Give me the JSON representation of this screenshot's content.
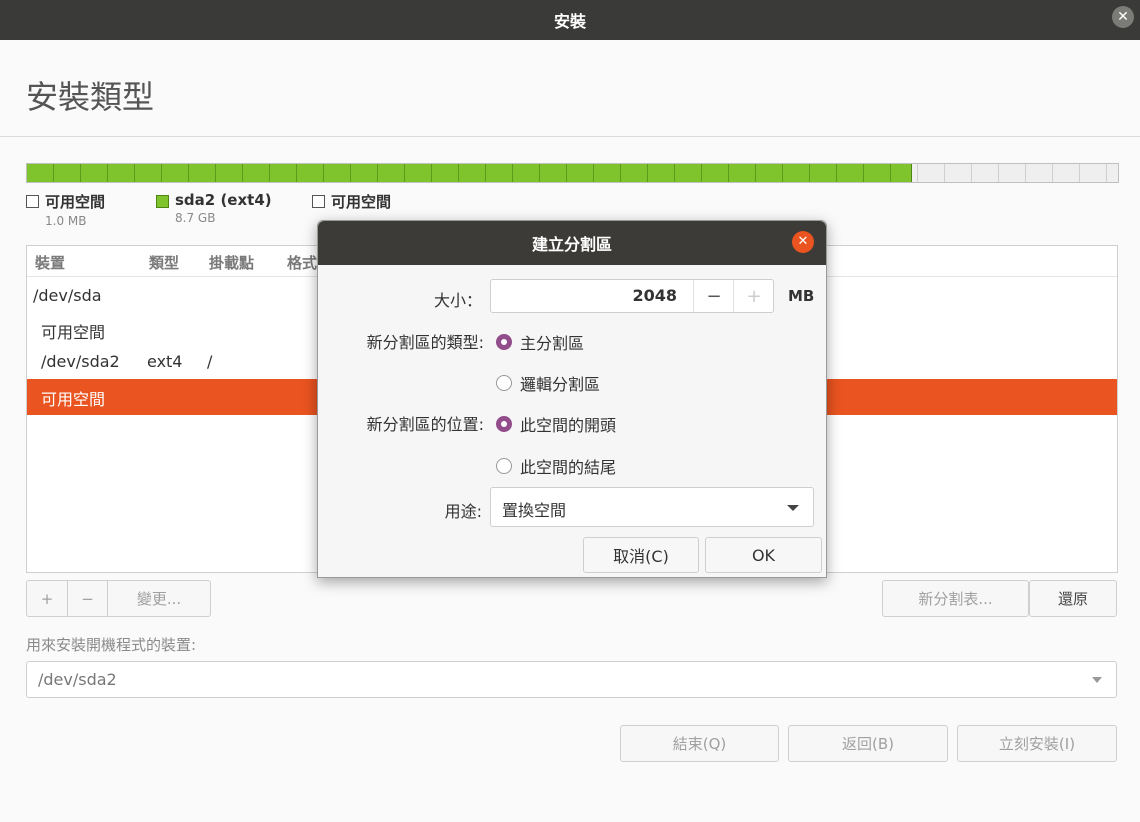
{
  "window": {
    "title": "安裝"
  },
  "page": {
    "title": "安裝類型"
  },
  "legend": [
    {
      "name": "可用空間",
      "size": "1.0 MB",
      "color": "#ffffff"
    },
    {
      "name": "sda2 (ext4)",
      "size": "8.7 GB",
      "color": "#7fc42c"
    },
    {
      "name": "可用空間",
      "size": "",
      "color": "#ffffff"
    }
  ],
  "diskbar": {
    "used_fraction": 0.81
  },
  "table": {
    "headers": [
      "裝置",
      "類型",
      "掛載點",
      "格式"
    ],
    "rows": [
      {
        "device": "/dev/sda",
        "type": "",
        "mount": ""
      },
      {
        "device": "可用空間",
        "type": "",
        "mount": ""
      },
      {
        "device": "/dev/sda2",
        "type": "ext4",
        "mount": "/"
      },
      {
        "device": "可用空間",
        "type": "",
        "mount": "",
        "selected": true
      }
    ]
  },
  "toolbar": {
    "add": "+",
    "remove": "−",
    "change": "變更...",
    "new_table": "新分割表...",
    "revert": "還原"
  },
  "boot": {
    "label": "用來安裝開機程式的裝置:",
    "value": "/dev/sda2"
  },
  "footer": {
    "quit": "結束(Q)",
    "back": "返回(B)",
    "install": "立刻安裝(I)"
  },
  "dialog": {
    "title": "建立分割區",
    "size_label": "大小：",
    "size_value": "2048",
    "minus": "−",
    "plus": "+",
    "unit": "MB",
    "type_label": "新分割區的類型:",
    "type_options": [
      "主分割區",
      "邏輯分割區"
    ],
    "location_label": "新分割區的位置:",
    "location_options": [
      "此空間的開頭",
      "此空間的結尾"
    ],
    "use_label": "用途:",
    "use_value": "置換空間",
    "cancel": "取消(C)",
    "ok": "OK"
  },
  "colors": {
    "accent": "#e95420",
    "radio": "#924d8b",
    "titlebar": "#3a3a38",
    "used": "#7fc42c"
  }
}
